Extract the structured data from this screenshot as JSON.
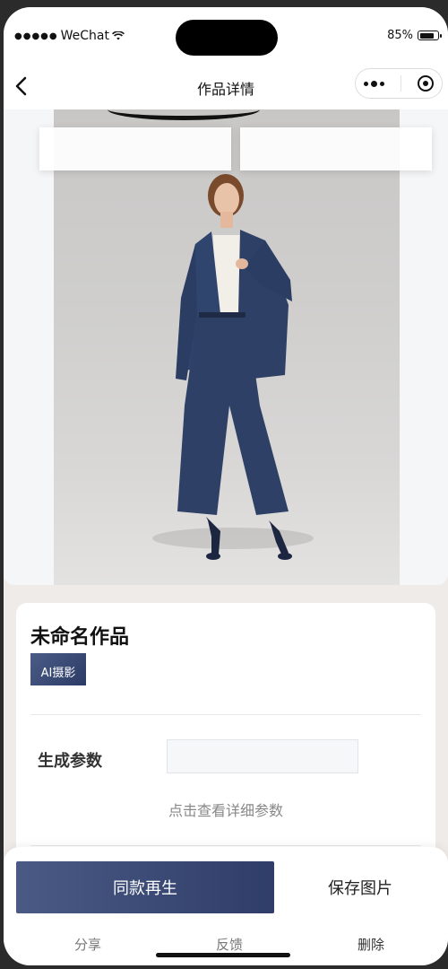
{
  "status_bar": {
    "carrier": "WeChat",
    "battery_percent_label": "85%",
    "battery_level": 0.85,
    "signal_icon": "signal-dots-icon",
    "wifi_icon": "wifi-icon"
  },
  "nav": {
    "title": "作品详情",
    "back_icon": "chevron-left-icon",
    "more_icon": "more-dots-icon",
    "close_icon": "target-circle-icon"
  },
  "work": {
    "title": "未命名作品",
    "tag": "AI摄影",
    "param_label": "生成参数",
    "detail_link": "点击查看详细参数"
  },
  "actions": {
    "primary": "同款再生",
    "secondary": "保存图片",
    "share": "分享",
    "feedback": "反馈",
    "delete": "删除"
  },
  "colors": {
    "accent": "#3b4a75",
    "background": "#efebe8",
    "suit": "#2e4066"
  }
}
